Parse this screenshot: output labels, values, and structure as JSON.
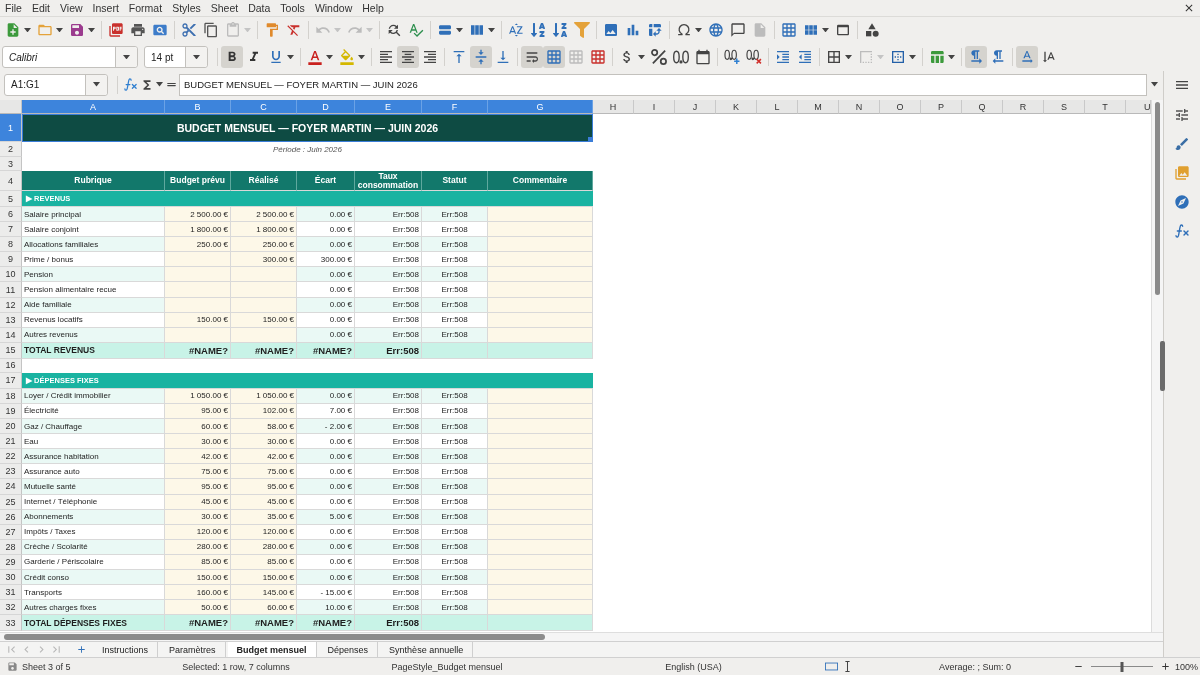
{
  "menu_bar": [
    "File",
    "Edit",
    "View",
    "Insert",
    "Format",
    "Styles",
    "Sheet",
    "Data",
    "Tools",
    "Window",
    "Help"
  ],
  "standard_toolbar": [
    {
      "disabled": false
    },
    {
      "disabled": false
    },
    {
      "disabled": false
    },
    {
      "disabled": false
    },
    {
      "disabled": false
    },
    {
      "disabled": false
    },
    {
      "disabled": false
    },
    {
      "disabled": false
    },
    {
      "disabled": true
    },
    {
      "disabled": false
    },
    {
      "disabled": false
    },
    {
      "disabled": true
    },
    {
      "disabled": true
    },
    {
      "disabled": false
    },
    {
      "disabled": false
    },
    {
      "disabled": false
    },
    {
      "disabled": false
    },
    {
      "disabled": false
    },
    {
      "disabled": false
    },
    {
      "disabled": false
    },
    {
      "disabled": false
    },
    {
      "disabled": false
    },
    {
      "disabled": false
    },
    {
      "disabled": false
    },
    {
      "disabled": false
    },
    {
      "disabled": false
    },
    {
      "disabled": false
    },
    {
      "disabled": true
    },
    {
      "disabled": false
    },
    {
      "disabled": false
    },
    {
      "disabled": false
    },
    {
      "disabled": false
    }
  ],
  "formatting_toolbar": {
    "font_name": "Calibri",
    "font_size": "14 pt",
    "buttons": [
      {
        "pressed": true,
        "disabled": false
      },
      {
        "pressed": false,
        "disabled": false
      },
      {
        "pressed": false,
        "disabled": false
      },
      {
        "pressed": false,
        "disabled": false
      },
      {
        "pressed": false,
        "disabled": false
      },
      {
        "pressed": false,
        "disabled": false
      },
      {
        "pressed": true,
        "disabled": false
      },
      {
        "pressed": false,
        "disabled": false
      },
      {
        "pressed": false,
        "disabled": false
      },
      {
        "pressed": true,
        "disabled": false
      },
      {
        "pressed": false,
        "disabled": false
      },
      {
        "pressed": true,
        "disabled": false
      },
      {
        "pressed": true,
        "disabled": false
      },
      {
        "pressed": false,
        "disabled": true
      },
      {
        "pressed": false,
        "disabled": false
      },
      {
        "pressed": false,
        "disabled": false
      },
      {
        "pressed": false,
        "disabled": false
      },
      {
        "pressed": false,
        "disabled": false
      },
      {
        "pressed": false,
        "disabled": false
      },
      {
        "pressed": false,
        "disabled": false
      },
      {
        "pressed": false,
        "disabled": false
      },
      {
        "pressed": false,
        "disabled": false
      },
      {
        "pressed": false,
        "disabled": false
      },
      {
        "pressed": false,
        "disabled": false
      },
      {
        "pressed": false,
        "disabled": true
      },
      {
        "pressed": false,
        "disabled": false
      },
      {
        "pressed": false,
        "disabled": false
      },
      {
        "pressed": true,
        "disabled": false
      },
      {
        "pressed": false,
        "disabled": false
      },
      {
        "pressed": true,
        "disabled": false
      },
      {
        "pressed": false,
        "disabled": false
      }
    ]
  },
  "formula_bar": {
    "name_box": "A1:G1",
    "formula": "BUDGET MENSUEL — FOYER MARTIN — JUIN 2026"
  },
  "sheet": {
    "columns": [
      {
        "label": "A",
        "selected": true
      },
      {
        "label": "B",
        "selected": true
      },
      {
        "label": "C",
        "selected": true
      },
      {
        "label": "D",
        "selected": true
      },
      {
        "label": "E",
        "selected": true
      },
      {
        "label": "F",
        "selected": true
      },
      {
        "label": "G",
        "selected": true
      },
      {
        "label": "H",
        "selected": false
      },
      {
        "label": "I",
        "selected": false
      },
      {
        "label": "J",
        "selected": false
      },
      {
        "label": "K",
        "selected": false
      },
      {
        "label": "L",
        "selected": false
      },
      {
        "label": "M",
        "selected": false
      },
      {
        "label": "N",
        "selected": false
      },
      {
        "label": "O",
        "selected": false
      },
      {
        "label": "P",
        "selected": false
      },
      {
        "label": "Q",
        "selected": false
      },
      {
        "label": "R",
        "selected": false
      },
      {
        "label": "S",
        "selected": false
      },
      {
        "label": "T",
        "selected": false
      },
      {
        "label": "U",
        "selected": false
      }
    ],
    "rows": [
      {
        "number": "1",
        "selected": true,
        "kind": "title",
        "text": "BUDGET MENSUEL — FOYER MARTIN — JUIN 2026"
      },
      {
        "number": "2",
        "selected": false,
        "kind": "note",
        "text": "Période : Juin 2026"
      },
      {
        "number": "3",
        "selected": false,
        "kind": "empty"
      },
      {
        "number": "4",
        "selected": false,
        "kind": "header",
        "headings": [
          "Rubrique",
          "Budget prévu",
          "Réalisé",
          "Écart",
          "Taux consommation",
          "Statut",
          "Commentaire"
        ]
      },
      {
        "number": "5",
        "selected": false,
        "kind": "section",
        "text": "▶ REVENUS"
      },
      {
        "number": "6",
        "selected": false,
        "kind": "data",
        "cells": {
          "item": "Salaire principal",
          "budget": "2 500.00 €",
          "actual": "2 500.00 €",
          "variance": "0.00 €",
          "rate": "Err:508",
          "status": "Err:508"
        }
      },
      {
        "number": "7",
        "selected": false,
        "kind": "data",
        "cells": {
          "item": "Salaire conjoint",
          "budget": "1 800.00 €",
          "actual": "1 800.00 €",
          "variance": "0.00 €",
          "rate": "Err:508",
          "status": "Err:508"
        }
      },
      {
        "number": "8",
        "selected": false,
        "kind": "data",
        "cells": {
          "item": "Allocations familiales",
          "budget": "250.00 €",
          "actual": "250.00 €",
          "variance": "0.00 €",
          "rate": "Err:508",
          "status": "Err:508"
        }
      },
      {
        "number": "9",
        "selected": false,
        "kind": "data",
        "cells": {
          "item": "Prime / bonus",
          "actual": "300.00 €",
          "variance": "300.00 €",
          "rate": "Err:508",
          "status": "Err:508"
        }
      },
      {
        "number": "10",
        "selected": false,
        "kind": "data",
        "cells": {
          "item": "Pension",
          "variance": "0.00 €",
          "rate": "Err:508",
          "status": "Err:508"
        }
      },
      {
        "number": "11",
        "selected": false,
        "kind": "data",
        "cells": {
          "item": "Pension alimentaire recue",
          "variance": "0.00 €",
          "rate": "Err:508",
          "status": "Err:508"
        }
      },
      {
        "number": "12",
        "selected": false,
        "kind": "data",
        "cells": {
          "item": "Aide familiale",
          "variance": "0.00 €",
          "rate": "Err:508",
          "status": "Err:508"
        }
      },
      {
        "number": "13",
        "selected": false,
        "kind": "data",
        "cells": {
          "item": "Revenus locatifs",
          "budget": "150.00 €",
          "actual": "150.00 €",
          "variance": "0.00 €",
          "rate": "Err:508",
          "status": "Err:508"
        }
      },
      {
        "number": "14",
        "selected": false,
        "kind": "data",
        "cells": {
          "item": "Autres revenus",
          "variance": "0.00 €",
          "rate": "Err:508",
          "status": "Err:508"
        }
      },
      {
        "number": "15",
        "selected": false,
        "kind": "total",
        "cells": {
          "item": "TOTAL REVENUS",
          "budget": "#NAME?",
          "actual": "#NAME?",
          "variance": "#NAME?",
          "rate": "Err:508"
        }
      },
      {
        "number": "16",
        "selected": false,
        "kind": "empty"
      },
      {
        "number": "17",
        "selected": false,
        "kind": "section",
        "text": "▶ DÉPENSES FIXES"
      },
      {
        "number": "18",
        "selected": false,
        "kind": "data",
        "cells": {
          "item": "Loyer / Crédit immobilier",
          "budget": "1 050.00 €",
          "actual": "1 050.00 €",
          "variance": "0.00 €",
          "rate": "Err:508",
          "status": "Err:508"
        }
      },
      {
        "number": "19",
        "selected": false,
        "kind": "data",
        "cells": {
          "item": "Électricité",
          "budget": "95.00 €",
          "actual": "102.00 €",
          "variance": "7.00 €",
          "rate": "Err:508",
          "status": "Err:508"
        }
      },
      {
        "number": "20",
        "selected": false,
        "kind": "data",
        "cells": {
          "item": "Gaz / Chauffage",
          "budget": "60.00 €",
          "actual": "58.00 €",
          "variance": "- 2.00 €",
          "rate": "Err:508",
          "status": "Err:508"
        }
      },
      {
        "number": "21",
        "selected": false,
        "kind": "data",
        "cells": {
          "item": "Eau",
          "budget": "30.00 €",
          "actual": "30.00 €",
          "variance": "0.00 €",
          "rate": "Err:508",
          "status": "Err:508"
        }
      },
      {
        "number": "22",
        "selected": false,
        "kind": "data",
        "cells": {
          "item": "Assurance habitation",
          "budget": "42.00 €",
          "actual": "42.00 €",
          "variance": "0.00 €",
          "rate": "Err:508",
          "status": "Err:508"
        }
      },
      {
        "number": "23",
        "selected": false,
        "kind": "data",
        "cells": {
          "item": "Assurance auto",
          "budget": "75.00 €",
          "actual": "75.00 €",
          "variance": "0.00 €",
          "rate": "Err:508",
          "status": "Err:508"
        }
      },
      {
        "number": "24",
        "selected": false,
        "kind": "data",
        "cells": {
          "item": "Mutuelle santé",
          "budget": "95.00 €",
          "actual": "95.00 €",
          "variance": "0.00 €",
          "rate": "Err:508",
          "status": "Err:508"
        }
      },
      {
        "number": "25",
        "selected": false,
        "kind": "data",
        "cells": {
          "item": "Internet / Téléphonie",
          "budget": "45.00 €",
          "actual": "45.00 €",
          "variance": "0.00 €",
          "rate": "Err:508",
          "status": "Err:508"
        }
      },
      {
        "number": "26",
        "selected": false,
        "kind": "data",
        "cells": {
          "item": "Abonnements",
          "budget": "30.00 €",
          "actual": "35.00 €",
          "variance": "5.00 €",
          "rate": "Err:508",
          "status": "Err:508"
        }
      },
      {
        "number": "27",
        "selected": false,
        "kind": "data",
        "cells": {
          "item": "Impôts / Taxes",
          "budget": "120.00 €",
          "actual": "120.00 €",
          "variance": "0.00 €",
          "rate": "Err:508",
          "status": "Err:508"
        }
      },
      {
        "number": "28",
        "selected": false,
        "kind": "data",
        "cells": {
          "item": "Crèche / Scolarité",
          "budget": "280.00 €",
          "actual": "280.00 €",
          "variance": "0.00 €",
          "rate": "Err:508",
          "status": "Err:508"
        }
      },
      {
        "number": "29",
        "selected": false,
        "kind": "data",
        "cells": {
          "item": "Garderie / Périscolaire",
          "budget": "85.00 €",
          "actual": "85.00 €",
          "variance": "0.00 €",
          "rate": "Err:508",
          "status": "Err:508"
        }
      },
      {
        "number": "30",
        "selected": false,
        "kind": "data",
        "cells": {
          "item": "Crédit conso",
          "budget": "150.00 €",
          "actual": "150.00 €",
          "variance": "0.00 €",
          "rate": "Err:508",
          "status": "Err:508"
        }
      },
      {
        "number": "31",
        "selected": false,
        "kind": "data",
        "cells": {
          "item": "Transports",
          "budget": "160.00 €",
          "actual": "145.00 €",
          "variance": "- 15.00 €",
          "rate": "Err:508",
          "status": "Err:508"
        }
      },
      {
        "number": "32",
        "selected": false,
        "kind": "data",
        "cells": {
          "item": "Autres charges fixes",
          "budget": "50.00 €",
          "actual": "60.00 €",
          "variance": "10.00 €",
          "rate": "Err:508",
          "status": "Err:508"
        }
      },
      {
        "number": "33",
        "selected": false,
        "kind": "total",
        "cells": {
          "item": "TOTAL DÉPENSES FIXES",
          "budget": "#NAME?",
          "actual": "#NAME?",
          "variance": "#NAME?",
          "rate": "Err:508"
        }
      }
    ]
  },
  "sheet_nav": [
    {
      "disabled": true
    },
    {
      "disabled": true
    },
    {
      "disabled": true
    },
    {
      "disabled": true
    }
  ],
  "sheet_tabs": [
    {
      "label": "Instructions",
      "selected": false
    },
    {
      "label": "Paramètres",
      "selected": false
    },
    {
      "label": "Budget mensuel",
      "selected": true
    },
    {
      "label": "Dépenses",
      "selected": false
    },
    {
      "label": "Synthèse annuelle",
      "selected": false
    }
  ],
  "status_bar": {
    "sheet_count": "Sheet 3 of 5",
    "selection": "Selected: 1 row, 7 columns",
    "page_style": "PageStyle_Budget mensuel",
    "language": "English (USA)",
    "summary": "Average: ; Sum: 0",
    "zoom": {
      "level": 0.5,
      "reading": "100%"
    }
  }
}
